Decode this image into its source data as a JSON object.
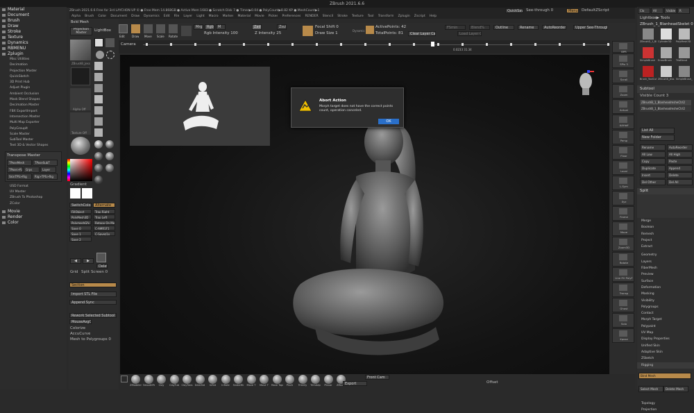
{
  "window": {
    "title": "ZBrush 2021.6.6"
  },
  "stats_text": "ZBrush 2021.6.6 Free for 3rd  LAYCHON UP ©  ● Free Mem 14.868GB ● Active Mem 1683 ● Scratch Disk 7 ● Timer▶0.04 ● PolyCount▶8.82 KP ● MeshCount▶1",
  "menu": [
    "Alpha",
    "Brush",
    "Color",
    "Document",
    "Draw",
    "Dynamics",
    "Edit",
    "File",
    "Layer",
    "Light",
    "Macro",
    "Marker",
    "Material",
    "Movie",
    "Picker",
    "Preferences",
    "RENDER",
    "Stencil",
    "Stroke",
    "Texture",
    "Tool",
    "Transform",
    "Zplugin",
    "Zscript",
    "Help"
  ],
  "menu_right": {
    "quicksave": "QuickSave",
    "seethrough": "See-through 0",
    "menus": "Menus",
    "defaultscript": "DefaultZScript"
  },
  "left_palette": {
    "headers_top": [
      {
        "id": "material",
        "label": "Material"
      },
      {
        "id": "document",
        "label": "Document"
      },
      {
        "id": "brush",
        "label": "Brush"
      },
      {
        "id": "draw",
        "label": "Draw"
      },
      {
        "id": "stroke",
        "label": "Stroke"
      },
      {
        "id": "texture",
        "label": "Texture"
      },
      {
        "id": "dynamics",
        "label": "Dynamics"
      },
      {
        "id": "rbmenu",
        "label": "RBMENU"
      },
      {
        "id": "zplugin",
        "label": "Zplugin"
      }
    ],
    "zplugin_items": [
      "Misc Utilities",
      "Decimation",
      "Projection Master",
      "QuickSketch",
      "3D Print Hub",
      "Adjust Plugin",
      "Ambient Occlusion",
      "Mask Blend Shapes",
      "Decimation Master",
      "FBX ExportImport",
      "Intersection Master",
      "Multi Map Exporter",
      "PolyGroupIt",
      "Scale Master",
      "SubTool Master",
      "Text 3D & Vector Shapes"
    ],
    "transpose_master": "Transpose Master",
    "tpose_buttons": [
      "TPoseMesh",
      "TPoseSubT",
      "TPose>Rig",
      "Grps",
      "Layer",
      "SkinTPS>Rig",
      "Rig>TPS>Rig"
    ],
    "after_items": [
      "USD Format",
      "UV Master",
      "ZBrush To Photoshop",
      "ZColor"
    ],
    "headers_bottom": [
      {
        "id": "movie",
        "label": "Movie"
      },
      {
        "id": "render",
        "label": "Render"
      },
      {
        "id": "color",
        "label": "Color"
      }
    ]
  },
  "shelf": {
    "bold_mesh": "Bold Mesh",
    "projection_master": "Projection Master",
    "lightbox": "LightBox",
    "alpha_off": "Alpha Off",
    "texture_off": "Texture Off",
    "tool_name": "ZBrushB_Jess",
    "gradient": "Gradient",
    "switchcolor": "SwitchColor",
    "alternate": "Alternate",
    "buttons": [
      "FillObject",
      "Trap Right",
      "PolyMesh3D",
      "Trap Left",
      "PolymeshGfx",
      "Retopo On Mesh 0",
      "Save 0",
      "C-AMR1F1",
      "Save 1",
      "C-Savez1x",
      "Save 2"
    ],
    "delete_label": "Delete",
    "grid_label": "Grid",
    "split_screen": "Split Screen 0",
    "section_label": "Section",
    "import_stl": "Import STL File",
    "append_sync": "Append Sync",
    "rework_buttons": [
      "Rework Selected Subtool",
      "MouseAvgQB"
    ],
    "extra_items": [
      "Colorize",
      "AccuCurve",
      "Mesh to Polygroups 0"
    ]
  },
  "toolbar": {
    "edit": "Edit",
    "draw": "Draw",
    "move": "Move",
    "scale": "Scale",
    "rotate": "Rotate",
    "mrgb": "Mrgb",
    "rgb": "Rgb",
    "m": "M",
    "rgb_intensity": "Rgb Intensity 100",
    "zadd": "Zadd",
    "zsub": "Zsub",
    "z_intensity": "Z Intensity 25",
    "focal_shift": "Focal Shift 0",
    "draw_size": "Draw Size 1",
    "dynamic": "Dynamic",
    "active_points": "ActivePoints: 42",
    "total_points": "TotalPoints: 81",
    "clear_layer": "Clear Layer Cache",
    "load_layer": "Load Layer Cache",
    "fsmin": "FSmin",
    "blendpct": "Blend%",
    "outline": "Outline",
    "rename": "Rename",
    "auto_reorder": "AutoReorder",
    "upper_seethrough": "Upper See-Through"
  },
  "timeline": {
    "camera_label": "Camera",
    "time_marker": "0.0233 31.34"
  },
  "dialog": {
    "title": "Abort Action",
    "message": "Morph target does not have the correct points count, operation canceled.",
    "ok": "OK"
  },
  "right_bar": [
    "BPR",
    "SPix 3",
    "Scroll",
    "Zoom",
    "Actual",
    "AAHalf",
    "Persp",
    "Floor",
    "Local",
    "L.Sym",
    "Xyz",
    "Frame",
    "Move",
    "Zoom3D",
    "Rotate",
    "Line Fill PolyF",
    "Transp",
    "Ghost",
    "Solo",
    "Xpose"
  ],
  "tool_tray": {
    "top_buttons": [
      "Clo",
      "All",
      "Visible",
      "R"
    ],
    "lightbox_tools": "Lightbox▶ Tools",
    "tool_title": "ZBrush_1_BlanheadSkelet 0",
    "thumb_labels": [
      "ZBrushD_1_BlanheadSkeleton",
      "Cylinder3D",
      "PolyMesh3D",
      "SimpleBrush",
      "EraseBrush",
      "TriaBlend",
      "Brush_ToolCutPGroup",
      "ZBrushB_Jess",
      "SimpleBrush_Sk",
      "SculptG_3D Z"
    ],
    "subtool_label": "Subtool",
    "visible_count": "Visible Count 3",
    "subtool_items": [
      "ZBrushB_1_BlanheadmsheCtrl2",
      "ZBrushB_1_BlanheadmsheCtrl2"
    ],
    "list_all": "List All",
    "new_folder": "New Folder",
    "actions": [
      "Rename",
      "AutoReorder",
      "All Low",
      "All High",
      "Copy",
      "Paste",
      "Duplicate",
      "Append",
      "Insert",
      "Delete",
      "Del Other",
      "Del All"
    ],
    "split_label": "Split",
    "merge_items": [
      "Merge",
      "Boolean",
      "Remesh",
      "Project",
      "Extract"
    ],
    "palettes": [
      "Geometry",
      "Layers",
      "FiberMesh",
      "Preview",
      "Surface",
      "Deformation",
      "Masking",
      "Visibility",
      "Polygroups",
      "Contact",
      "Morph Target",
      "Polypaint",
      "UV Map",
      "Display Properties",
      "Unified Skin",
      "Adaptive Skin",
      "ZSketch",
      "Rigging"
    ],
    "rigging_buttons": [
      "Bind Mesh",
      "Select Mesh",
      "Delete Mesh"
    ],
    "bottom_items": [
      "Topology",
      "Projection"
    ]
  },
  "brushes": [
    "ZModeler",
    "SmoothPeaks",
    "Clay",
    "ClayTub",
    "ClayTubs",
    "DamStd",
    "Inflat",
    "Inflate",
    "SnakeHk",
    "Move T",
    "Move T",
    "Move Topo",
    "Pinch",
    "TrimDy",
    "TrimAdp",
    "Planar",
    "ZModel"
  ],
  "bottom": {
    "front_cam": "Front Cam",
    "export": "Export",
    "offset": "Offset"
  },
  "colors": {
    "accent": "#b88a4a",
    "ok_blue": "#2a6fc9",
    "viewport": "#101010"
  }
}
